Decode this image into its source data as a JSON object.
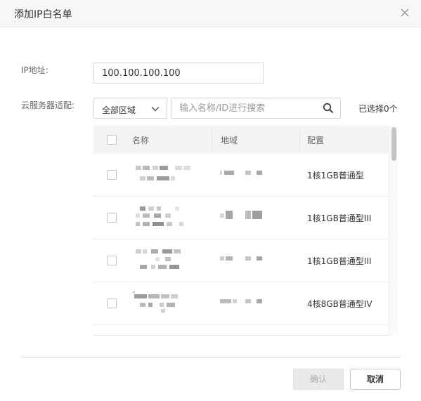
{
  "dialog": {
    "title": "添加IP白名单"
  },
  "form": {
    "ip_label": "IP地址:",
    "ip_value": "100.100.100.100",
    "server_label": "云服务器适配:",
    "region_value": "全部区域",
    "search_placeholder": "输入名称/ID进行搜索",
    "selected_count": "已选择0个"
  },
  "table": {
    "columns": [
      "名称",
      "地域",
      "配置"
    ],
    "rows": [
      {
        "config": "1核1GB普通型"
      },
      {
        "config": "1核1GB普通型III"
      },
      {
        "config": "1核1GB普通型III"
      },
      {
        "config": "4核8GB普通型IV"
      }
    ]
  },
  "footer": {
    "confirm_label": "确认",
    "cancel_label": "取消"
  },
  "icons": {
    "close": "close-icon",
    "chevron": "chevron-down-icon",
    "search": "search-icon"
  },
  "colors": {
    "header_bg": "#f7f7f7",
    "border": "#d6d6d6",
    "disabled_button": "#eaeaea"
  }
}
